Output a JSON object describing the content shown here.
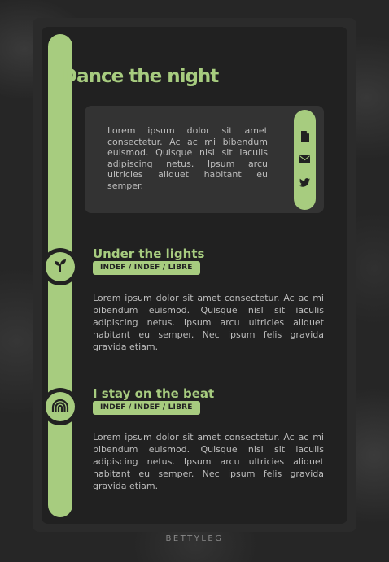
{
  "theme": {
    "accent": "#a7cc7f",
    "background": "#212121",
    "panel": "#333333",
    "text": "#bdbdbd"
  },
  "header": {
    "title": "Dance the night"
  },
  "intro": {
    "text": "Lorem ipsum dolor sit amet consectetur. Ac ac mi bibendum euismod. Quisque nisl sit iaculis adipiscing netus. Ipsum arcu ultricies aliquet habitant eu semper."
  },
  "social": {
    "items": [
      {
        "icon": "document-icon"
      },
      {
        "icon": "envelope-icon"
      },
      {
        "icon": "twitter-icon"
      }
    ]
  },
  "sections": [
    {
      "icon": "sprout-icon",
      "title": "Under the lights",
      "tag": "INDEF / INDEF / LIBRE",
      "text": "Lorem ipsum dolor sit amet consectetur. Ac ac mi bibendum euismod. Quisque nisl sit iaculis adipiscing netus. Ipsum arcu ultricies aliquet habitant eu semper. Nec ipsum felis gravida gravida etiam."
    },
    {
      "icon": "rainbow-icon",
      "title": "I stay on the beat",
      "tag": "INDEF / INDEF / LIBRE",
      "text": "Lorem ipsum dolor sit amet consectetur. Ac ac mi bibendum euismod. Quisque nisl sit iaculis adipiscing netus. Ipsum arcu ultricies aliquet habitant eu semper. Nec ipsum felis gravida gravida etiam."
    }
  ],
  "footer": {
    "credit": "BETTYLEG"
  }
}
